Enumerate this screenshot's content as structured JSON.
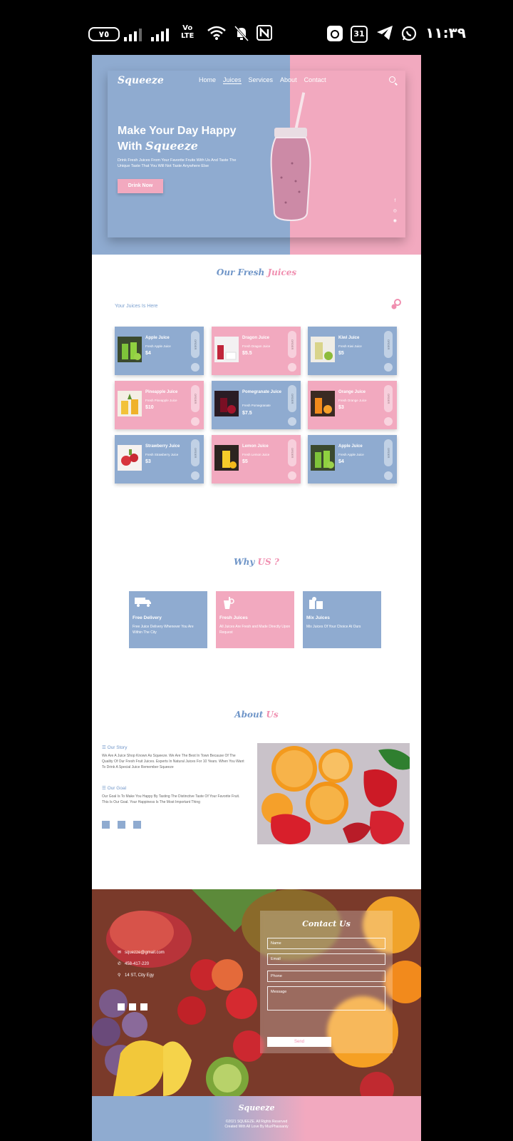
{
  "status_bar": {
    "battery": "٧٥",
    "volte": "Vo\nLTE",
    "calendar_day": "31",
    "time": "١١:٣٩"
  },
  "hero": {
    "logo": "Squeeze",
    "nav": [
      "Home",
      "Juices",
      "Services",
      "About",
      "Contact"
    ],
    "title_line1": "Make Your Day Happy",
    "title_with": "With ",
    "title_brand": "Squeeze",
    "description": "Drink Fresh Juices From Your Favorite Fruits With Us And Taste The Unique Taste That You Will Not Taste Anywhere Else",
    "button": "Drink Now",
    "social": [
      "f",
      "◎",
      "◉"
    ]
  },
  "juices": {
    "title_a": "Our Fresh ",
    "title_b": "Juices",
    "subtitle": "Your Juices Is Here",
    "order_label": "ORDER",
    "items": [
      {
        "name": "Apple Juice",
        "desc": "Fresh Apple Juice",
        "price": "$4"
      },
      {
        "name": "Dragon Juice",
        "desc": "Fresh Dragon Juice",
        "price": "$5.5"
      },
      {
        "name": "Kiwi Juice",
        "desc": "Fresh Kiwi Juice",
        "price": "$5"
      },
      {
        "name": "Pineapple Juice",
        "desc": "Fresh Pineapple Juice",
        "price": "$10"
      },
      {
        "name": "Pomegranate Juice",
        "desc": "Fresh Pomegranate",
        "price": "$7.5"
      },
      {
        "name": "Orange Juice",
        "desc": "Fresh Orange Juice",
        "price": "$3"
      },
      {
        "name": "Strawberry Juice",
        "desc": "Fresh Strawberry Juice",
        "price": "$3"
      },
      {
        "name": "Lemon Juice",
        "desc": "Fresh Lemon Juice",
        "price": "$5"
      },
      {
        "name": "Apple Juice",
        "desc": "Fresh Apple Juice",
        "price": "$4"
      }
    ]
  },
  "why": {
    "title_a": "Why ",
    "title_b": "US ?",
    "cards": [
      {
        "title": "Free Delivery",
        "desc": "Free Juice Delivery Whenever You Are Within The City"
      },
      {
        "title": "Fresh Juices",
        "desc": "All Juices Are Fresh and Made Directly Upon Request"
      },
      {
        "title": "Mix Juices",
        "desc": "Mix Juices Of Your Choice At Ours"
      }
    ]
  },
  "about": {
    "title_a": "About ",
    "title_b": "Us",
    "story_heading": "Our Story",
    "story_text": "We Are A Juice Shop Known As Squeeze. We Are The Best In Town Because Of The Quality Of Our Fresh Fruit Juices. Experts In Natural Juices For 10 Years. When You Want To Drink A Special Juice Remember Squeeze",
    "goal_heading": "Our Goal",
    "goal_text": "Our Goal Is To Make You Happy By Tasting The Distinctive Taste Of Your Favorite Fruit. This Is Our Goal. Your Happiness Is The Most Important Thing"
  },
  "contact": {
    "email": "squezze@gmail.com",
    "phone": "458-417-220",
    "address": "14 ST, City Egy",
    "form_title": "Contact Us",
    "fields": [
      "Name",
      "Email",
      "Phone",
      "Message"
    ],
    "send": "Send"
  },
  "footer": {
    "logo": "Squeeze",
    "copyright": "©2021 SQUEEZE. All Rights Reserved",
    "credit": "Created With All Love By MuzPhassaniy"
  },
  "colors": {
    "blue": "#8fabd0",
    "pink": "#f2a9bf"
  }
}
